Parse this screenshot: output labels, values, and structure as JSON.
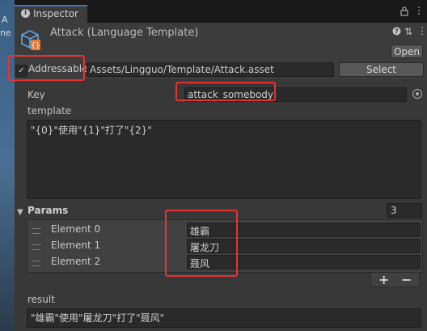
{
  "left_strip": {
    "fragment_1": "ne",
    "fragment_2": "A"
  },
  "tab": {
    "label": "Inspector",
    "icon": "info-icon"
  },
  "header": {
    "title": "Attack (Language Template)",
    "open_label": "Open",
    "icons": [
      "help-icon",
      "preset-icon",
      "more-icon"
    ]
  },
  "addressable": {
    "checked": true,
    "check_glyph": "✓",
    "label": "Addressable",
    "path": "Assets/Lingguo/Template/Attack.asset",
    "select_label": "Select"
  },
  "fields": {
    "key_label": "Key",
    "key_value": "attack_somebody",
    "template_label": "template",
    "template_value": "\"{0}\"使用\"{1}\"打了\"{2}\"",
    "params_label": "Params",
    "params_count": "3",
    "params": [
      {
        "label": "Element 0",
        "value": "雄霸"
      },
      {
        "label": "Element 1",
        "value": "屠龙刀"
      },
      {
        "label": "Element 2",
        "value": "聂风"
      }
    ],
    "plus_label": "+",
    "minus_label": "−",
    "result_label": "result",
    "result_value": "\"雄霸\"使用\"屠龙刀\"打了\"聂风\""
  },
  "colors": {
    "highlight": "#e53333",
    "tab_accent": "#3a79bb",
    "panel": "#383838"
  }
}
